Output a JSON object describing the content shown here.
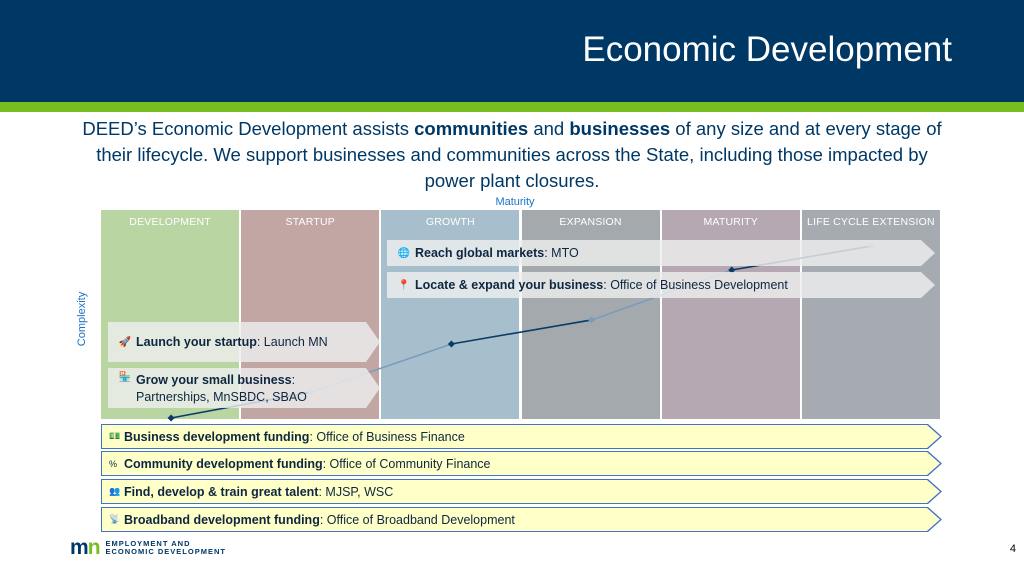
{
  "header": {
    "title": "Economic Development",
    "background": "#003865",
    "stripe": "#78be20"
  },
  "intro": {
    "part1": "DEED’s Economic Development assists ",
    "bold1": "communities",
    "part2": " and ",
    "bold2": "businesses",
    "part3": " of any size and at every stage of their lifecycle. We support businesses and communities across the State, including those impacted by power plant closures."
  },
  "axes": {
    "x_label": "Maturity",
    "y_label": "Complexity"
  },
  "stages": [
    {
      "label": "DEVELOPMENT",
      "color": "#b9d5a2"
    },
    {
      "label": "STARTUP",
      "color": "#c1a6a4"
    },
    {
      "label": "GROWTH",
      "color": "#a7bfcc"
    },
    {
      "label": "EXPANSION",
      "color": "#a3a9ac"
    },
    {
      "label": "MATURITY",
      "color": "#b5a8b3"
    },
    {
      "label": "LIFE CYCLE EXTENSION",
      "color": "#a6aab1"
    }
  ],
  "curve": {
    "points": [
      {
        "stage": 0.5,
        "level": 0.0
      },
      {
        "stage": 1.5,
        "level": 0.14
      },
      {
        "stage": 2.5,
        "level": 0.4
      },
      {
        "stage": 3.5,
        "level": 0.53
      },
      {
        "stage": 4.5,
        "level": 0.8
      },
      {
        "stage": 5.5,
        "level": 0.93
      }
    ],
    "colors": [
      "#0b3a66",
      "#7a9cbc"
    ]
  },
  "services": {
    "global": {
      "icon": "globe-icon",
      "bold": "Reach global markets",
      "rest": ": MTO"
    },
    "locate": {
      "icon": "pin-icon",
      "bold": "Locate & expand your business",
      "rest": ": Office of Business Development"
    },
    "startup": {
      "icon": "rocket-icon",
      "bold": "Launch your startup",
      "rest": ": Launch MN"
    },
    "small": {
      "icon": "store-icon",
      "bold": "Grow your small business",
      "rest": ":",
      "line2": "Partnerships, MnSBDC, SBAO"
    }
  },
  "funding": [
    {
      "icon": "money-icon",
      "bold": "Business development funding",
      "rest": ": Office of Business Finance"
    },
    {
      "icon": "percent-icon",
      "bold": "Community development funding",
      "rest": ": Office of Community Finance"
    },
    {
      "icon": "people-icon",
      "bold": "Find, develop & train great talent",
      "rest": ": MJSP, WSC"
    },
    {
      "icon": "antenna-icon",
      "bold": "Broadband development funding",
      "rest": ": Office of Broadband Development"
    }
  ],
  "footer": {
    "logo_mark_m": "m",
    "logo_mark_n": "n",
    "logo_line1": "EMPLOYMENT AND",
    "logo_line2": "ECONOMIC DEVELOPMENT",
    "page_number": "4"
  }
}
